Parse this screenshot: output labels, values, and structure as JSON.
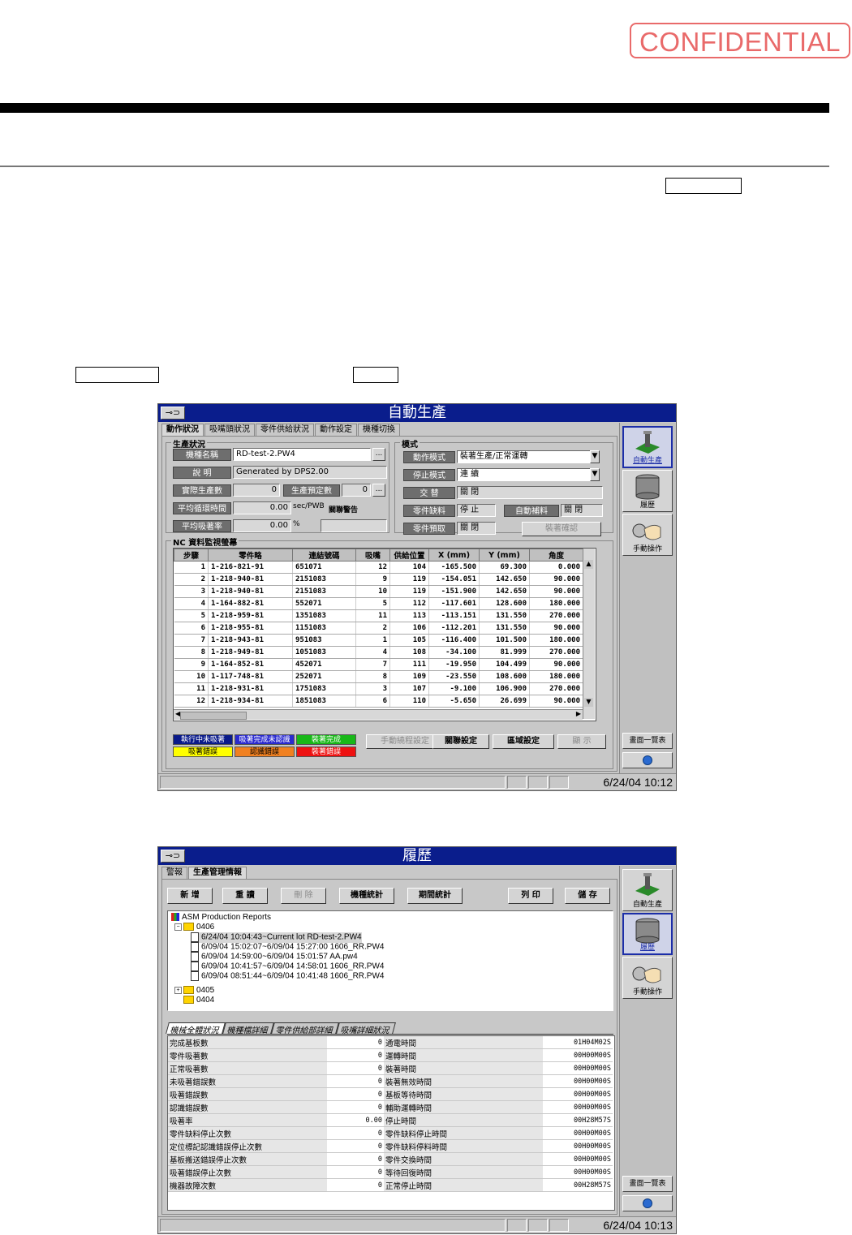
{
  "stamp": "CONFIDENTIAL",
  "win1": {
    "title": "自動生產",
    "key_icon": "⊸⊃",
    "tabs": [
      "動作狀況",
      "吸嘴頭狀況",
      "零件供給狀況",
      "動作設定",
      "機種切換"
    ],
    "prod_group": "生產狀況",
    "labels": {
      "pcb_name": "機種名稱",
      "desc": "說 明",
      "actual": "實際生產數",
      "planned": "生產預定數",
      "avg_cycle": "平均循環時間",
      "avg_pick": "平均吸著率"
    },
    "values": {
      "pcb_name": "RD-test-2.PW4",
      "desc": "Generated by DPS2.00",
      "actual": "0",
      "planned": "0",
      "avg_cycle": "0.00",
      "avg_pick": "0.00",
      "unit_cycle": "sec/PWB",
      "unit_pct": "%",
      "related": "關聯警告",
      "ellipsis": "..."
    },
    "mode_group": "模式",
    "mode_labels": {
      "op_mode": "動作模式",
      "stop_mode": "停止模式",
      "alternate": "交 替",
      "part_feed": "零件缺料",
      "auto_feed": "自動補料",
      "pre_fetch": "零件預取"
    },
    "mode_values": {
      "op_mode": "裝著生產/正常運轉",
      "stop_mode": "連 續",
      "alternate": "關 閉",
      "part_feed": "停 止",
      "auto_feed": "關 閉",
      "pre_fetch": "關 閉",
      "confirm_btn": "裝著確認"
    },
    "nc_group": "NC 資料監視螢幕",
    "nc_headers": [
      "步驟",
      "零件略",
      "連結號碼",
      "吸嘴",
      "供給位置",
      "X (mm)",
      "Y (mm)",
      "角度"
    ],
    "nc_rows": [
      [
        "1",
        "1-216-821-91",
        "651071",
        "12",
        "104",
        "-165.500",
        "69.300",
        "0.000"
      ],
      [
        "2",
        "1-218-940-81",
        "2151083",
        "9",
        "119",
        "-154.051",
        "142.650",
        "90.000"
      ],
      [
        "3",
        "1-218-940-81",
        "2151083",
        "10",
        "119",
        "-151.900",
        "142.650",
        "90.000"
      ],
      [
        "4",
        "1-164-882-81",
        "552071",
        "5",
        "112",
        "-117.601",
        "128.600",
        "180.000"
      ],
      [
        "5",
        "1-218-959-81",
        "1351083",
        "11",
        "113",
        "-113.151",
        "131.550",
        "270.000"
      ],
      [
        "6",
        "1-218-955-81",
        "1151083",
        "2",
        "106",
        "-112.201",
        "131.550",
        "90.000"
      ],
      [
        "7",
        "1-218-943-81",
        "951083",
        "1",
        "105",
        "-116.400",
        "101.500",
        "180.000"
      ],
      [
        "8",
        "1-218-949-81",
        "1051083",
        "4",
        "108",
        "-34.100",
        "81.999",
        "270.000"
      ],
      [
        "9",
        "1-164-852-81",
        "452071",
        "7",
        "111",
        "-19.950",
        "104.499",
        "90.000"
      ],
      [
        "10",
        "1-117-748-81",
        "252071",
        "8",
        "109",
        "-23.550",
        "108.600",
        "180.000"
      ],
      [
        "11",
        "1-218-931-81",
        "1751083",
        "3",
        "107",
        "-9.100",
        "106.900",
        "270.000"
      ],
      [
        "12",
        "1-218-934-81",
        "1851083",
        "6",
        "110",
        "-5.650",
        "26.699",
        "90.000"
      ]
    ],
    "legend": [
      {
        "text": "執行中未吸著",
        "bg": "#0a1a8a",
        "fg": "#ffffff"
      },
      {
        "text": "吸著完成未認識",
        "bg": "#2a2ad0",
        "fg": "#ffffff"
      },
      {
        "text": "裝著完成",
        "bg": "#18b818",
        "fg": "#ffffff"
      },
      {
        "text": "吸著錯誤",
        "bg": "#ffff00",
        "fg": "#000000"
      },
      {
        "text": "認識錯誤",
        "bg": "#f08020",
        "fg": "#000000"
      },
      {
        "text": "裝著錯誤",
        "bg": "#ee1111",
        "fg": "#ffffff"
      }
    ],
    "buttons": {
      "manual_skip": "手動繞程設定",
      "skip_set": "關聯設定",
      "area_set": "區域設定",
      "display": "顯 示"
    },
    "side": {
      "auto": "自動生產",
      "history": "履歷",
      "manual": "手動操作",
      "list": "畫面一覽表"
    },
    "clock": "6/24/04 10:12"
  },
  "win2": {
    "title": "履歷",
    "tabs": [
      "警報",
      "生產管理情報"
    ],
    "buttons": {
      "new": "新 增",
      "reload": "重 讀",
      "delete": "刪 除",
      "model_stat": "機種統計",
      "period_stat": "期間統計",
      "print": "列 印",
      "save": "儲 存"
    },
    "tree": {
      "root": "ASM Production Reports",
      "folder1": "0406",
      "items": [
        "6/24/04 10:04:43~Current lot  RD-test-2.PW4",
        "6/09/04 15:02:07~6/09/04 15:27:00  1606_RR.PW4",
        "6/09/04 14:59:00~6/09/04 15:01:57  AA.pw4",
        "6/09/04 10:41:57~6/09/04 14:58:01  1606_RR.PW4",
        "6/09/04 08:51:44~6/09/04 10:41:48  1606_RR.PW4"
      ],
      "folder2": "0405",
      "folder3": "0404"
    },
    "subtabs": [
      "機械全體狀況",
      "機種檔詳細",
      "零件供給部詳細",
      "吸嘴詳細狀況"
    ],
    "stats": [
      [
        "完成基板數",
        "0",
        "通電時間",
        "01H04M02S"
      ],
      [
        "零件吸著數",
        "0",
        "運轉時間",
        "00H00M00S"
      ],
      [
        "正常吸著數",
        "0",
        "裝著時間",
        "00H00M00S"
      ],
      [
        "未吸著錯誤數",
        "0",
        "裝著無效時間",
        "00H00M00S"
      ],
      [
        "吸著錯誤數",
        "0",
        "基板等待時間",
        "00H00M00S"
      ],
      [
        "認識錯誤數",
        "0",
        "輔助運轉時間",
        "00H00M00S"
      ],
      [
        "吸著率",
        "0.00",
        "停止時間",
        "00H28M57S"
      ],
      [
        "零件缺料停止次數",
        "0",
        "零件缺料停止時間",
        "00H00M00S"
      ],
      [
        "定位標記認識錯誤停止次數",
        "0",
        "零件缺料停料時間",
        "00H00M00S"
      ],
      [
        "基板搬送錯誤停止次數",
        "0",
        "零件交換時間",
        "00H00M00S"
      ],
      [
        "吸著錯誤停止次數",
        "0",
        "等待回復時間",
        "00H00M00S"
      ],
      [
        "機器故障次數",
        "0",
        "正常停止時間",
        "00H28M57S"
      ]
    ],
    "clock": "6/24/04 10:13"
  }
}
